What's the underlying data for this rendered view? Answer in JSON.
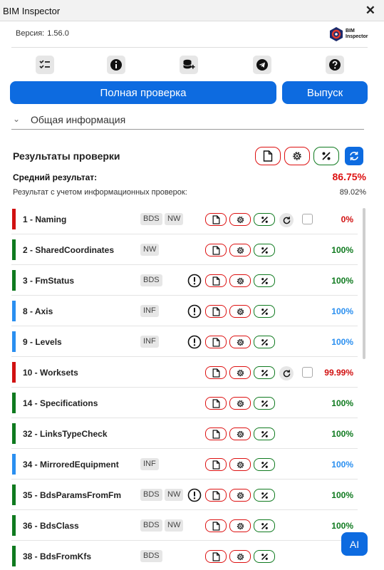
{
  "window": {
    "title": "BIM Inspector",
    "close_glyph": "✕"
  },
  "header": {
    "version_label": "Версия:",
    "version_value": "1.56.0",
    "logo_text_1": "BIM",
    "logo_text_2": "Inspector"
  },
  "toolbar": {
    "icons": [
      "checklist-icon",
      "info-icon",
      "database-add-icon",
      "telegram-icon",
      "help-icon"
    ]
  },
  "actions": {
    "full_check": "Полная проверка",
    "release": "Выпуск"
  },
  "general_section": {
    "label": "Общая информация"
  },
  "results": {
    "title": "Результаты проверки",
    "average_label": "Средний результат:",
    "average_value": "86.75%",
    "info_label": "Результат с учетом информационных проверок:",
    "info_value": "89.02%"
  },
  "colors": {
    "accent": "#0d6be0",
    "red": "#d11111",
    "green": "#0f7a1f",
    "blue": "#2a8ff0"
  },
  "checks": [
    {
      "name": "1 - Naming",
      "tags": [
        "BDS",
        "NW"
      ],
      "warning": false,
      "rerun": true,
      "result": "0%",
      "status": "red"
    },
    {
      "name": "2 - SharedCoordinates",
      "tags": [
        "NW"
      ],
      "warning": false,
      "rerun": false,
      "result": "100%",
      "status": "green"
    },
    {
      "name": "3 - FmStatus",
      "tags": [
        "BDS"
      ],
      "warning": true,
      "rerun": false,
      "result": "100%",
      "status": "green"
    },
    {
      "name": "8 - Axis",
      "tags": [
        "INF"
      ],
      "warning": true,
      "rerun": false,
      "result": "100%",
      "status": "blue"
    },
    {
      "name": "9 - Levels",
      "tags": [
        "INF"
      ],
      "warning": true,
      "rerun": false,
      "result": "100%",
      "status": "blue"
    },
    {
      "name": "10 - Worksets",
      "tags": [],
      "warning": false,
      "rerun": true,
      "result": "99.99%",
      "status": "red"
    },
    {
      "name": "14 - Specifications",
      "tags": [],
      "warning": false,
      "rerun": false,
      "result": "100%",
      "status": "green"
    },
    {
      "name": "32 - LinksTypeCheck",
      "tags": [],
      "warning": false,
      "rerun": false,
      "result": "100%",
      "status": "green"
    },
    {
      "name": "34 - MirroredEquipment",
      "tags": [
        "INF"
      ],
      "warning": false,
      "rerun": false,
      "result": "100%",
      "status": "blue"
    },
    {
      "name": "35 - BdsParamsFromFm",
      "tags": [
        "BDS",
        "NW"
      ],
      "warning": true,
      "rerun": false,
      "result": "100%",
      "status": "green"
    },
    {
      "name": "36 - BdsClass",
      "tags": [
        "BDS",
        "NW"
      ],
      "warning": false,
      "rerun": false,
      "result": "100%",
      "status": "green"
    },
    {
      "name": "38 - BdsFromKfs",
      "tags": [
        "BDS"
      ],
      "warning": false,
      "rerun": false,
      "result": "",
      "status": "green"
    }
  ],
  "ai_button": "AI"
}
